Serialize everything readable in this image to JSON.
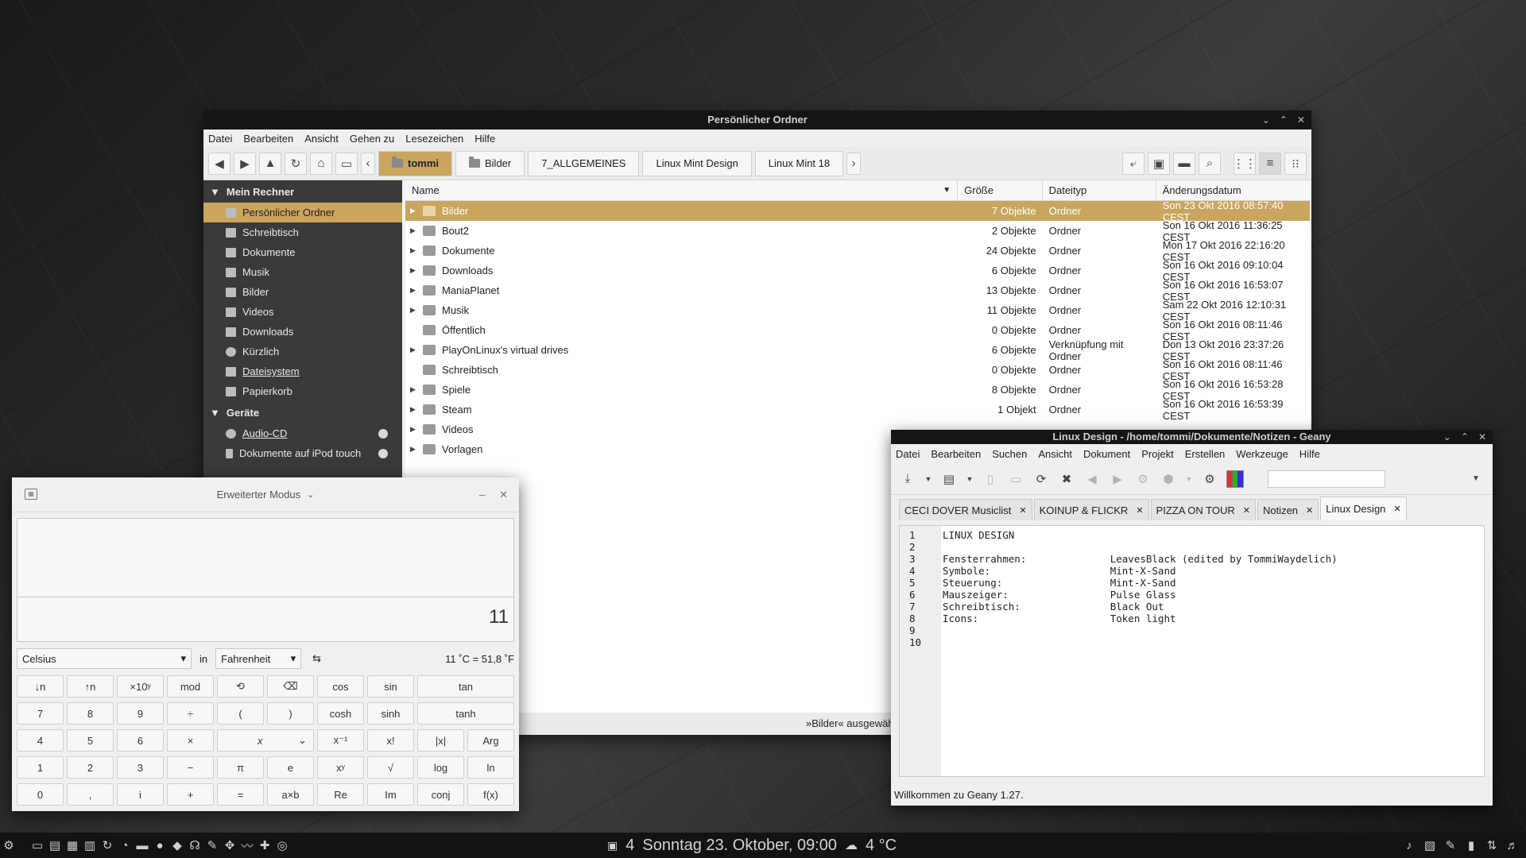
{
  "nemo": {
    "title": "Persönlicher Ordner",
    "menu": [
      "Datei",
      "Bearbeiten",
      "Ansicht",
      "Gehen zu",
      "Lesezeichen",
      "Hilfe"
    ],
    "breadcrumbs": [
      "tommi",
      "Bilder",
      "7_ALLGEMEINES",
      "Linux Mint Design",
      "Linux Mint 18"
    ],
    "sidebar_section_computer": "Mein Rechner",
    "sidebar_items": [
      "Persönlicher Ordner",
      "Schreibtisch",
      "Dokumente",
      "Musik",
      "Bilder",
      "Videos",
      "Downloads",
      "Kürzlich",
      "Dateisystem",
      "Papierkorb"
    ],
    "sidebar_section_devices": "Geräte",
    "device_items": [
      "Audio-CD",
      "Dokumente auf iPod touch"
    ],
    "columns": {
      "name": "Name",
      "size": "Größe",
      "type": "Dateityp",
      "date": "Änderungsdatum"
    },
    "files": [
      {
        "name": "Bilder",
        "size": "7 Objekte",
        "type": "Ordner",
        "date": "Son 23 Okt 2016 08:57:40 CEST"
      },
      {
        "name": "Bout2",
        "size": "2 Objekte",
        "type": "Ordner",
        "date": "Son 16 Okt 2016 11:36:25 CEST"
      },
      {
        "name": "Dokumente",
        "size": "24 Objekte",
        "type": "Ordner",
        "date": "Mon 17 Okt 2016 22:16:20 CEST"
      },
      {
        "name": "Downloads",
        "size": "6 Objekte",
        "type": "Ordner",
        "date": "Son 16 Okt 2016 09:10:04 CEST"
      },
      {
        "name": "ManiaPlanet",
        "size": "13 Objekte",
        "type": "Ordner",
        "date": "Son 16 Okt 2016 16:53:07 CEST"
      },
      {
        "name": "Musik",
        "size": "11 Objekte",
        "type": "Ordner",
        "date": "Sam 22 Okt 2016 12:10:31 CEST"
      },
      {
        "name": "Öffentlich",
        "size": "0 Objekte",
        "type": "Ordner",
        "date": "Son 16 Okt 2016 08:11:46 CEST"
      },
      {
        "name": "PlayOnLinux's virtual drives",
        "size": "6 Objekte",
        "type": "Verknüpfung mit Ordner",
        "date": "Don 13 Okt 2016 23:37:26 CEST"
      },
      {
        "name": "Schreibtisch",
        "size": "0 Objekte",
        "type": "Ordner",
        "date": "Son 16 Okt 2016 08:11:46 CEST"
      },
      {
        "name": "Spiele",
        "size": "8 Objekte",
        "type": "Ordner",
        "date": "Son 16 Okt 2016 16:53:28 CEST"
      },
      {
        "name": "Steam",
        "size": "1 Objekt",
        "type": "Ordner",
        "date": "Son 16 Okt 2016 16:53:39 CEST"
      },
      {
        "name": "Videos",
        "size": "",
        "type": "",
        "date": ""
      },
      {
        "name": "Vorlagen",
        "size": "",
        "type": "",
        "date": ""
      }
    ],
    "status": "»Bilder« ausgewählt (enthält 7 Objekte), Freier Speicherplatz: 2,4"
  },
  "calculator": {
    "title": "Erweiterter Modus",
    "display_value": "11",
    "from_unit": "Celsius",
    "in_label": "in",
    "to_unit": "Fahrenheit",
    "conversion_result": "11 ˚C = 51,8 ˚F",
    "rows": [
      [
        "↓n",
        "↑n",
        "×10ʸ",
        "mod",
        "⟲",
        "⌫",
        "cos",
        "sin",
        "tan"
      ],
      [
        "7",
        "8",
        "9",
        "÷",
        "(",
        ")",
        "cosh",
        "sinh",
        "tanh"
      ],
      [
        "4",
        "5",
        "6",
        "×",
        "x",
        "x⁻¹",
        "x!",
        "|x|",
        "Arg"
      ],
      [
        "1",
        "2",
        "3",
        "−",
        "π",
        "e",
        "xʸ",
        "√",
        "log",
        "ln"
      ],
      [
        "0",
        ",",
        "i",
        "+",
        "=",
        "a×b",
        "Re",
        "Im",
        "conj",
        "f(x)"
      ]
    ]
  },
  "geany": {
    "title": "Linux Design - /home/tommi/Dokumente/Notizen - Geany",
    "menu": [
      "Datei",
      "Bearbeiten",
      "Suchen",
      "Ansicht",
      "Dokument",
      "Projekt",
      "Erstellen",
      "Werkzeuge",
      "Hilfe"
    ],
    "tabs": [
      "CECI DOVER Musiclist",
      "KOINUP & FLICKR",
      "PIZZA ON TOUR",
      "Notizen",
      "Linux Design"
    ],
    "lines": [
      "LINUX DESIGN",
      "",
      "Fensterrahmen:              LeavesBlack (edited by TommiWaydelich)",
      "Symbole:                    Mint-X-Sand",
      "Steuerung:                  Mint-X-Sand",
      "Mauszeiger:                 Pulse Glass",
      "Schreibtisch:               Black Out",
      "Icons:                      Token light",
      "",
      ""
    ],
    "line_numbers": [
      "1",
      "2",
      "3",
      "4",
      "5",
      "6",
      "7",
      "8",
      "9",
      "10"
    ],
    "status": "Willkommen zu Geany 1.27."
  },
  "panel": {
    "workspace": "4",
    "datetime": "Sonntag 23. Oktober, 09:00",
    "temperature": "4 °C"
  }
}
